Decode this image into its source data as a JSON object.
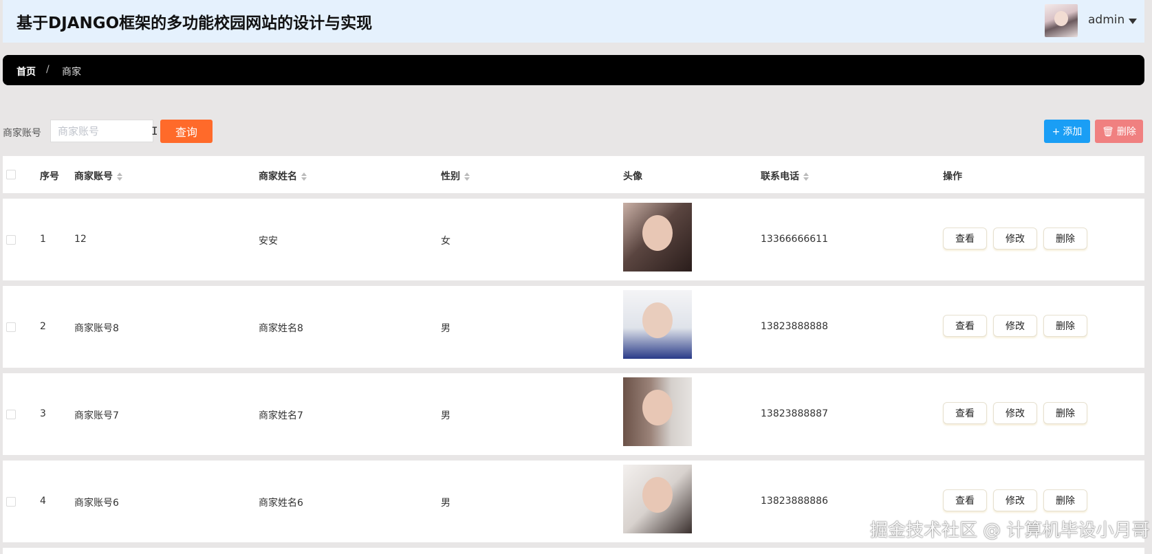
{
  "header": {
    "title": "基于DJANGO框架的多功能校园网站的设计与实现",
    "username": "admin"
  },
  "breadcrumb": {
    "home": "首页",
    "separator": "/",
    "current": "商家"
  },
  "search": {
    "label": "商家账号",
    "placeholder": "商家账号",
    "query_button": "查询"
  },
  "toolbar": {
    "add_label": "添加",
    "delete_label": "删除"
  },
  "table": {
    "headers": {
      "index": "序号",
      "account": "商家账号",
      "name": "商家姓名",
      "gender": "性别",
      "avatar": "头像",
      "phone": "联系电话",
      "actions": "操作"
    },
    "rows": [
      {
        "index": "1",
        "account": "12",
        "name": "安安",
        "gender": "女",
        "phone": "13366666611"
      },
      {
        "index": "2",
        "account": "商家账号8",
        "name": "商家姓名8",
        "gender": "男",
        "phone": "13823888888"
      },
      {
        "index": "3",
        "account": "商家账号7",
        "name": "商家姓名7",
        "gender": "男",
        "phone": "13823888887"
      },
      {
        "index": "4",
        "account": "商家账号6",
        "name": "商家姓名6",
        "gender": "男",
        "phone": "13823888886"
      }
    ],
    "row_actions": {
      "view": "查看",
      "edit": "修改",
      "delete": "删除"
    }
  },
  "watermark": "掘金技术社区 @ 计算机毕设小月哥",
  "colors": {
    "header_bg": "#e5f1fd",
    "breadcrumb_bg": "#000000",
    "query_button": "#ff6a2a",
    "add_button": "#1a9ef5",
    "delete_button": "#f08080"
  }
}
